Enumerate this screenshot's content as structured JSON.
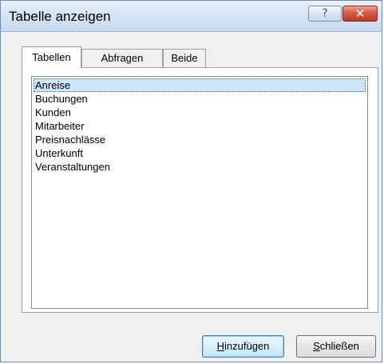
{
  "window": {
    "title": "Tabelle anzeigen",
    "help_label": "?",
    "close_label": "✕"
  },
  "tabs": [
    {
      "label": "Tabellen",
      "active": true
    },
    {
      "label": "Abfragen",
      "active": false
    },
    {
      "label": "Beide",
      "active": false
    }
  ],
  "list": {
    "selected_index": 0,
    "items": [
      "Anreise",
      "Buchungen",
      "Kunden",
      "Mitarbeiter",
      "Preisnachlässe",
      "Unterkunft",
      "Veranstaltungen"
    ]
  },
  "buttons": {
    "add": {
      "mnemonic": "H",
      "rest": "inzufügen"
    },
    "close": {
      "mnemonic": "S",
      "rest": "chließen"
    }
  },
  "colors": {
    "selection": "#cce4f7",
    "close_button": "#c23a24",
    "titlebar": "#d6e4f5"
  }
}
